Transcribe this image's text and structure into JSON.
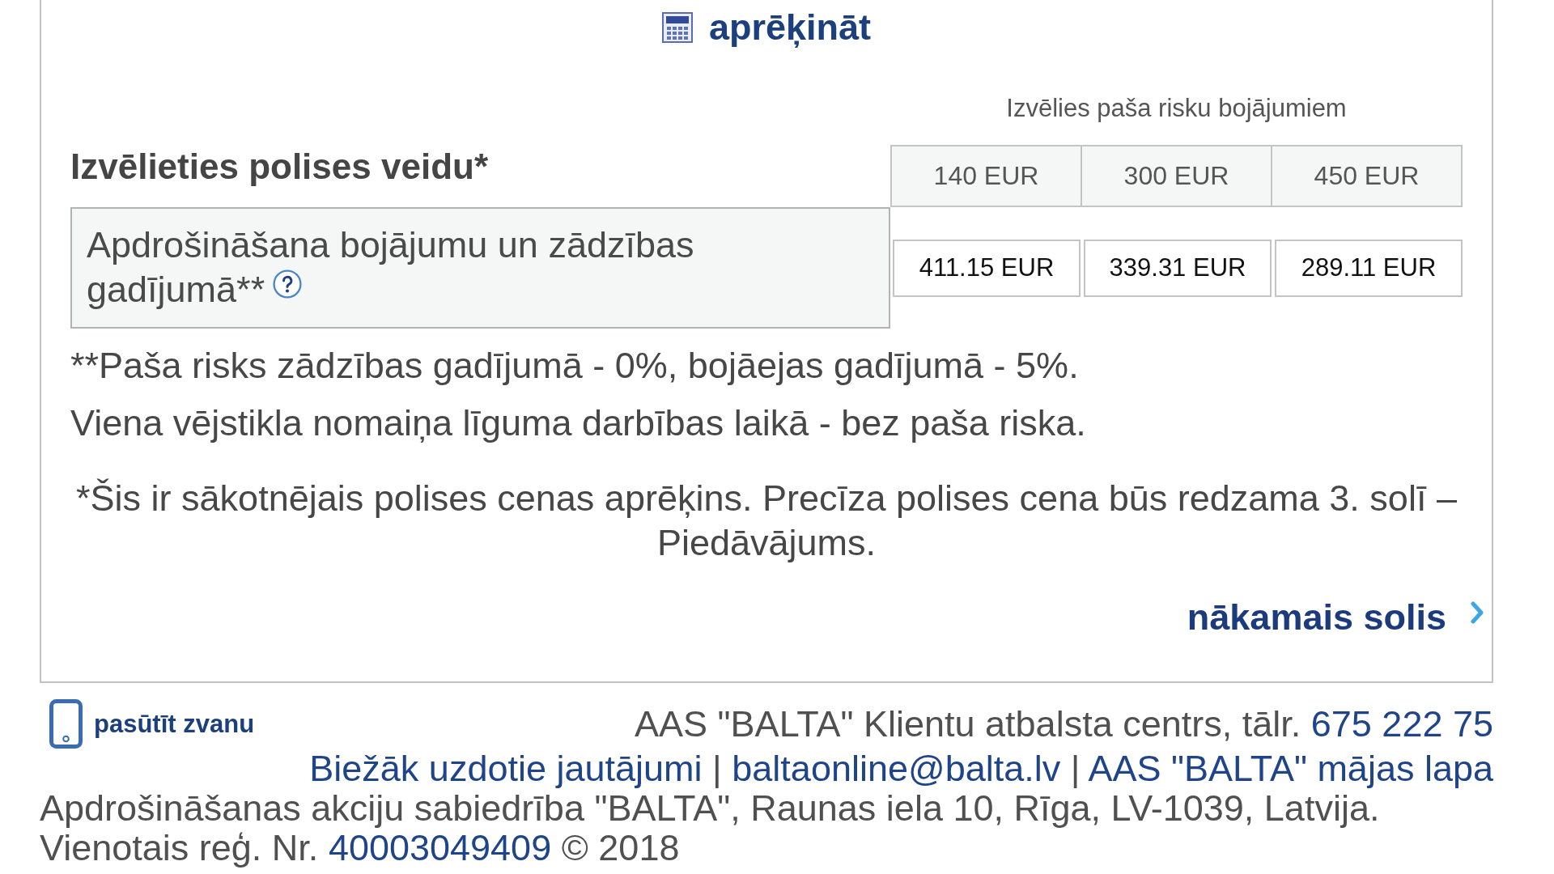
{
  "header": {
    "title": "aprēķināt"
  },
  "deductible": {
    "caption": "Izvēlies paša risku bojājumiem",
    "options": [
      "140 EUR",
      "300 EUR",
      "450 EUR"
    ]
  },
  "policy": {
    "heading": "Izvēlieties polises veidu*",
    "types": [
      {
        "name_lines": [
          "Apdrošināšana bojājumu un zādzības",
          "gadījumā**"
        ],
        "prices": [
          "411.15 EUR",
          "339.31 EUR",
          "289.11 EUR"
        ]
      }
    ]
  },
  "notes": [
    "**Paša risks zādzības gadījumā - 0%, bojāejas gadījumā - 5%.",
    "Viena vējstikla nomaiņa līguma darbības laikā - bez paša riska."
  ],
  "disclaimer": "*Šis ir sākotnējais polises cenas aprēķins. Precīza polises cena būs redzama 3. solī – Piedāvājums.",
  "next_button": {
    "label": "nākamais solis"
  },
  "footer": {
    "call_link": {
      "label": "pasūtīt zvanu"
    },
    "contact_line": [
      {
        "kind": "text",
        "text": "AAS \"BALTA\" Klientu atbalsta centrs, tālr."
      },
      {
        "kind": "link",
        "text": "675 222 75"
      }
    ],
    "links_line": [
      {
        "kind": "link",
        "text": "Biežāk uzdotie jautājumi"
      },
      {
        "kind": "text",
        "text": "|"
      },
      {
        "kind": "link",
        "text": "baltaonline@balta.lv"
      },
      {
        "kind": "text",
        "text": "|"
      },
      {
        "kind": "link",
        "text": "AAS \"BALTA\" mājas lapa"
      }
    ],
    "address_line": [
      {
        "kind": "text",
        "text": "Apdrošināšanas akciju sabiedrība \"BALTA\", Raunas iela 10, Rīga, LV-1039, Latvija."
      }
    ],
    "registration_line": [
      {
        "kind": "text",
        "text": "Vienotais reģ. Nr."
      },
      {
        "kind": "link",
        "text": "40003049409"
      },
      {
        "kind": "text",
        "text": "© 2018"
      }
    ]
  }
}
